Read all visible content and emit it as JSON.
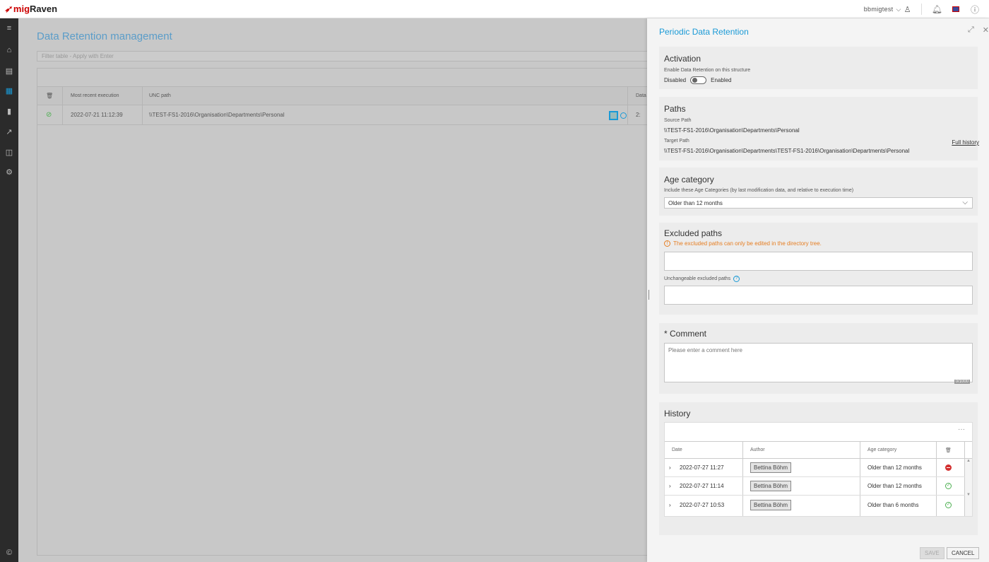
{
  "app": {
    "logo_text_prefix": "mig",
    "logo_text_suffix": "Raven",
    "user": "bbmigtest",
    "icons": [
      "user-icon",
      "bell-icon",
      "flag-icon",
      "help-icon"
    ]
  },
  "sidebar": {
    "items": [
      "menu-icon",
      "home-icon",
      "document-icon",
      "folder-icon",
      "chart-icon",
      "trend-icon",
      "graph-icon",
      "settings-icon",
      "copyright-icon"
    ]
  },
  "main": {
    "title": "Data Retention management",
    "filter_placeholder": "Filter table - Apply with Enter",
    "columns": [
      "Most recent execution",
      "UNC path",
      "Data"
    ],
    "row": {
      "execution": "2022-07-21 11:12:39",
      "path": "\\\\TEST-FS1-2016\\Organisation\\Departments\\Personal",
      "data_prefix": "2:"
    }
  },
  "panel": {
    "title": "Periodic Data Retention",
    "activation": {
      "title": "Activation",
      "label": "Enable Data Retention on this structure",
      "off_label": "Disabled",
      "on_label": "Enabled",
      "enabled": false
    },
    "paths": {
      "title": "Paths",
      "source_label": "Source Path",
      "source_value": "\\\\TEST-FS1-2016\\Organisation\\Departments\\Personal",
      "target_label": "Target Path",
      "target_value": "\\\\TEST-FS1-2016\\Organisation\\Departments\\TEST-FS1-2016\\Organisation\\Departments\\Personal"
    },
    "age": {
      "title": "Age category",
      "label": "Include these Age Categories (by last modification data, and relative to execution time)",
      "selected": "Older than 12 months"
    },
    "excluded": {
      "title": "Excluded paths",
      "warning": "The excluded paths can only be edited in the directory tree.",
      "unchangeable_label": "Unchangeable excluded paths"
    },
    "comment": {
      "title": "* Comment",
      "placeholder": "Please enter a comment here",
      "counter": "0/1000"
    },
    "history": {
      "title": "History",
      "columns": [
        "Date",
        "Author",
        "Age category"
      ],
      "rows": [
        {
          "date": "2022-07-27 11:27",
          "author": "Bettina Böhm",
          "age": "Older than 12 months",
          "status": "disabled"
        },
        {
          "date": "2022-07-27 11:14",
          "author": "Bettina Böhm",
          "age": "Older than 12 months",
          "status": "enabled"
        },
        {
          "date": "2022-07-27 10:53",
          "author": "Bettina Böhm",
          "age": "Older than 6 months",
          "status": "enabled"
        }
      ],
      "full_history_label": "Full history"
    },
    "buttons": {
      "save": "SAVE",
      "cancel": "CANCEL"
    }
  },
  "colors": {
    "accent": "#1a9ad6",
    "sidebar_bg": "#2b2b2b",
    "warning": "#e67e22",
    "success": "#4caf50",
    "danger": "#d32f2f"
  }
}
